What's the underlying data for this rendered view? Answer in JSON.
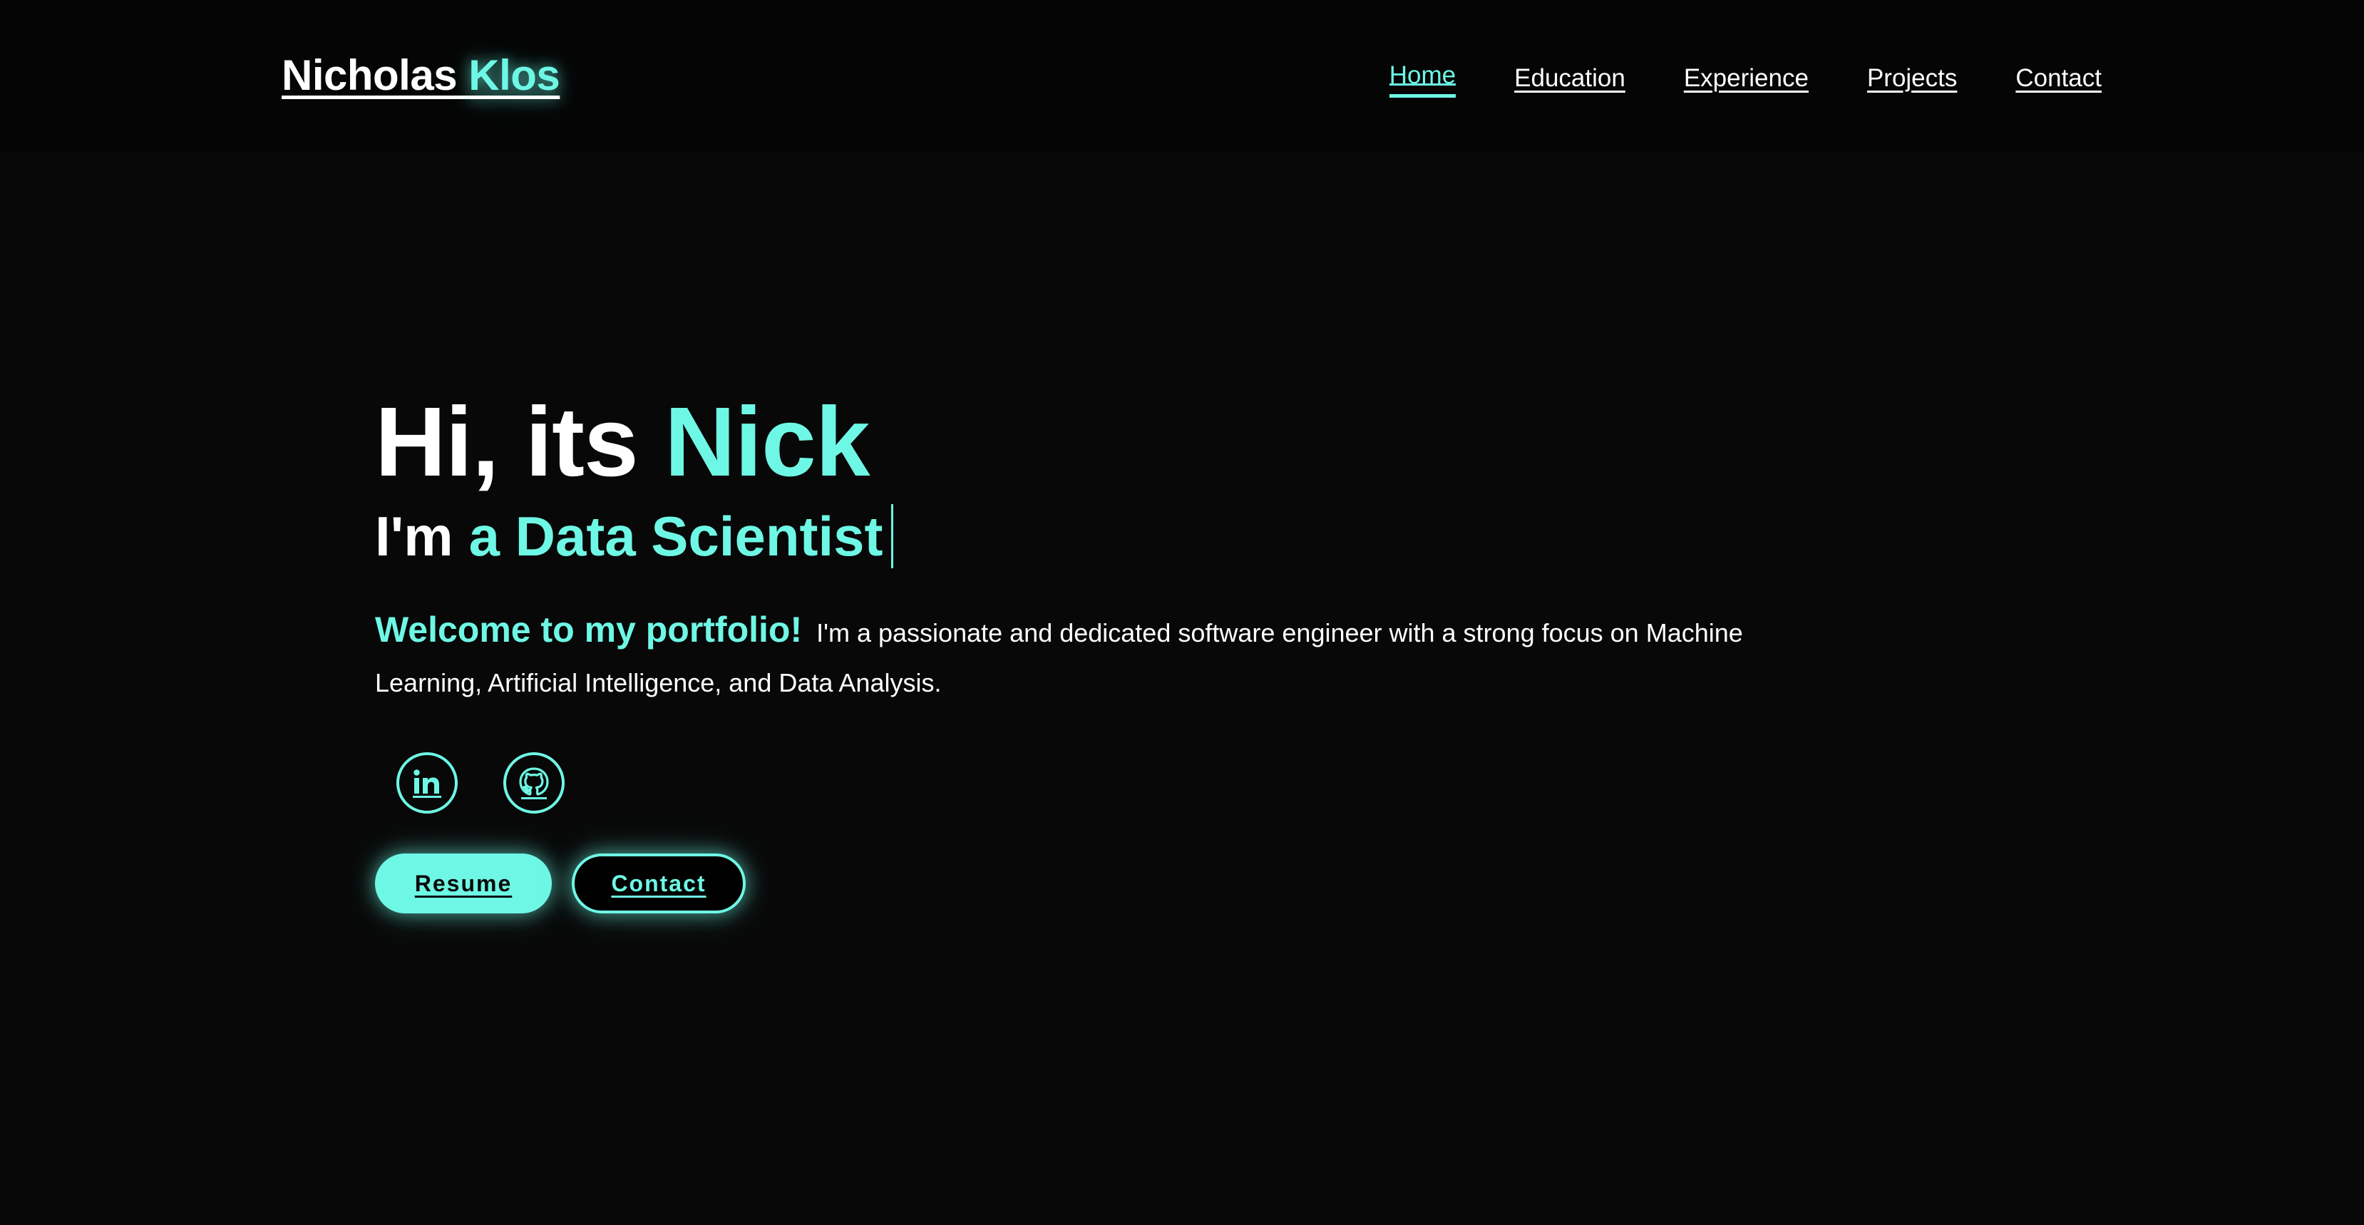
{
  "header": {
    "logo_first": "Nicholas",
    "logo_last": "Klos",
    "nav": [
      {
        "label": "Home",
        "active": true
      },
      {
        "label": "Education",
        "active": false
      },
      {
        "label": "Experience",
        "active": false
      },
      {
        "label": "Projects",
        "active": false
      },
      {
        "label": "Contact",
        "active": false
      }
    ]
  },
  "hero": {
    "greeting": "Hi, its",
    "name": "Nick",
    "subtitle_prefix": "I'm",
    "subtitle_typed": "a Data Scientist",
    "welcome": "Welcome to my portfolio!",
    "intro": "I'm a passionate and dedicated software engineer with a strong focus on Machine Learning, Artificial Intelligence, and Data Analysis.",
    "socials": [
      {
        "icon": "linkedin-icon"
      },
      {
        "icon": "github-icon"
      }
    ],
    "buttons": {
      "resume": "Resume",
      "contact": "Contact"
    }
  },
  "colors": {
    "background": "#080808",
    "accent": "#6ef7e5",
    "text": "#ffffff"
  }
}
